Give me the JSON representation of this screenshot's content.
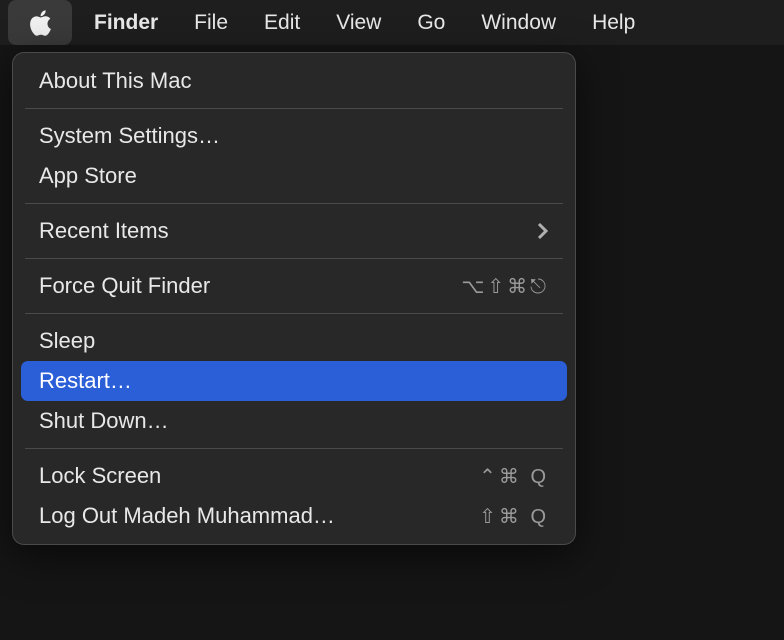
{
  "menubar": {
    "apple": "apple-logo",
    "app": "Finder",
    "items": [
      "File",
      "Edit",
      "View",
      "Go",
      "Window",
      "Help"
    ]
  },
  "apple_menu": {
    "about": "About This Mac",
    "system_settings": "System Settings…",
    "app_store": "App Store",
    "recent_items": "Recent Items",
    "force_quit": "Force Quit Finder",
    "force_quit_shortcut": "⌥⇧⌘⎋",
    "sleep": "Sleep",
    "restart": "Restart…",
    "shutdown": "Shut Down…",
    "lock_screen": "Lock Screen",
    "lock_screen_shortcut": "⌃⌘ Q",
    "logout": "Log Out Madeh Muhammad…",
    "logout_shortcut": "⇧⌘ Q"
  },
  "highlighted_item": "restart"
}
